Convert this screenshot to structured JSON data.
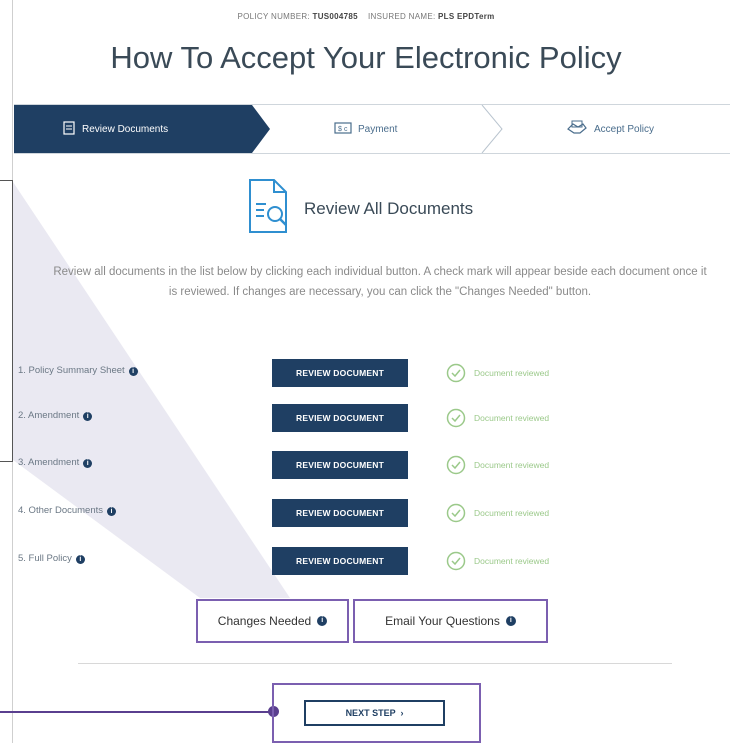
{
  "header": {
    "policy_label": "POLICY NUMBER:",
    "policy_number": "TUS004785",
    "insured_label": "INSURED NAME:",
    "insured_name": "PLS EPDTerm",
    "title": "How To Accept Your Electronic Policy"
  },
  "steps": [
    {
      "label": "Review Documents",
      "icon": "document-icon",
      "active": true
    },
    {
      "label": "Payment",
      "icon": "payment-icon",
      "active": false
    },
    {
      "label": "Accept Policy",
      "icon": "handshake-icon",
      "active": false
    }
  ],
  "review": {
    "title": "Review All Documents",
    "icon": "document-search-icon",
    "description": "Review all documents in the list below by clicking each individual button. A check mark will appear beside each document once it is reviewed. If changes are necessary, you can click the \"Changes Needed\" button."
  },
  "documents": [
    {
      "label": "1.  Policy Summary Sheet",
      "button": "REVIEW DOCUMENT",
      "status": "Document reviewed"
    },
    {
      "label": "2.  Amendment",
      "button": "REVIEW DOCUMENT",
      "status": "Document reviewed"
    },
    {
      "label": "3.  Amendment",
      "button": "REVIEW DOCUMENT",
      "status": "Document reviewed"
    },
    {
      "label": "4.  Other Documents",
      "button": "REVIEW DOCUMENT",
      "status": "Document reviewed"
    },
    {
      "label": "5.  Full Policy",
      "button": "REVIEW DOCUMENT",
      "status": "Document reviewed"
    }
  ],
  "actions": {
    "changes_needed": "Changes Needed",
    "email_questions": "Email Your Questions"
  },
  "next_step": "NEXT STEP",
  "colors": {
    "primary": "#1f3f63",
    "highlight": "#7b5fb0",
    "success": "#9bc98a"
  }
}
